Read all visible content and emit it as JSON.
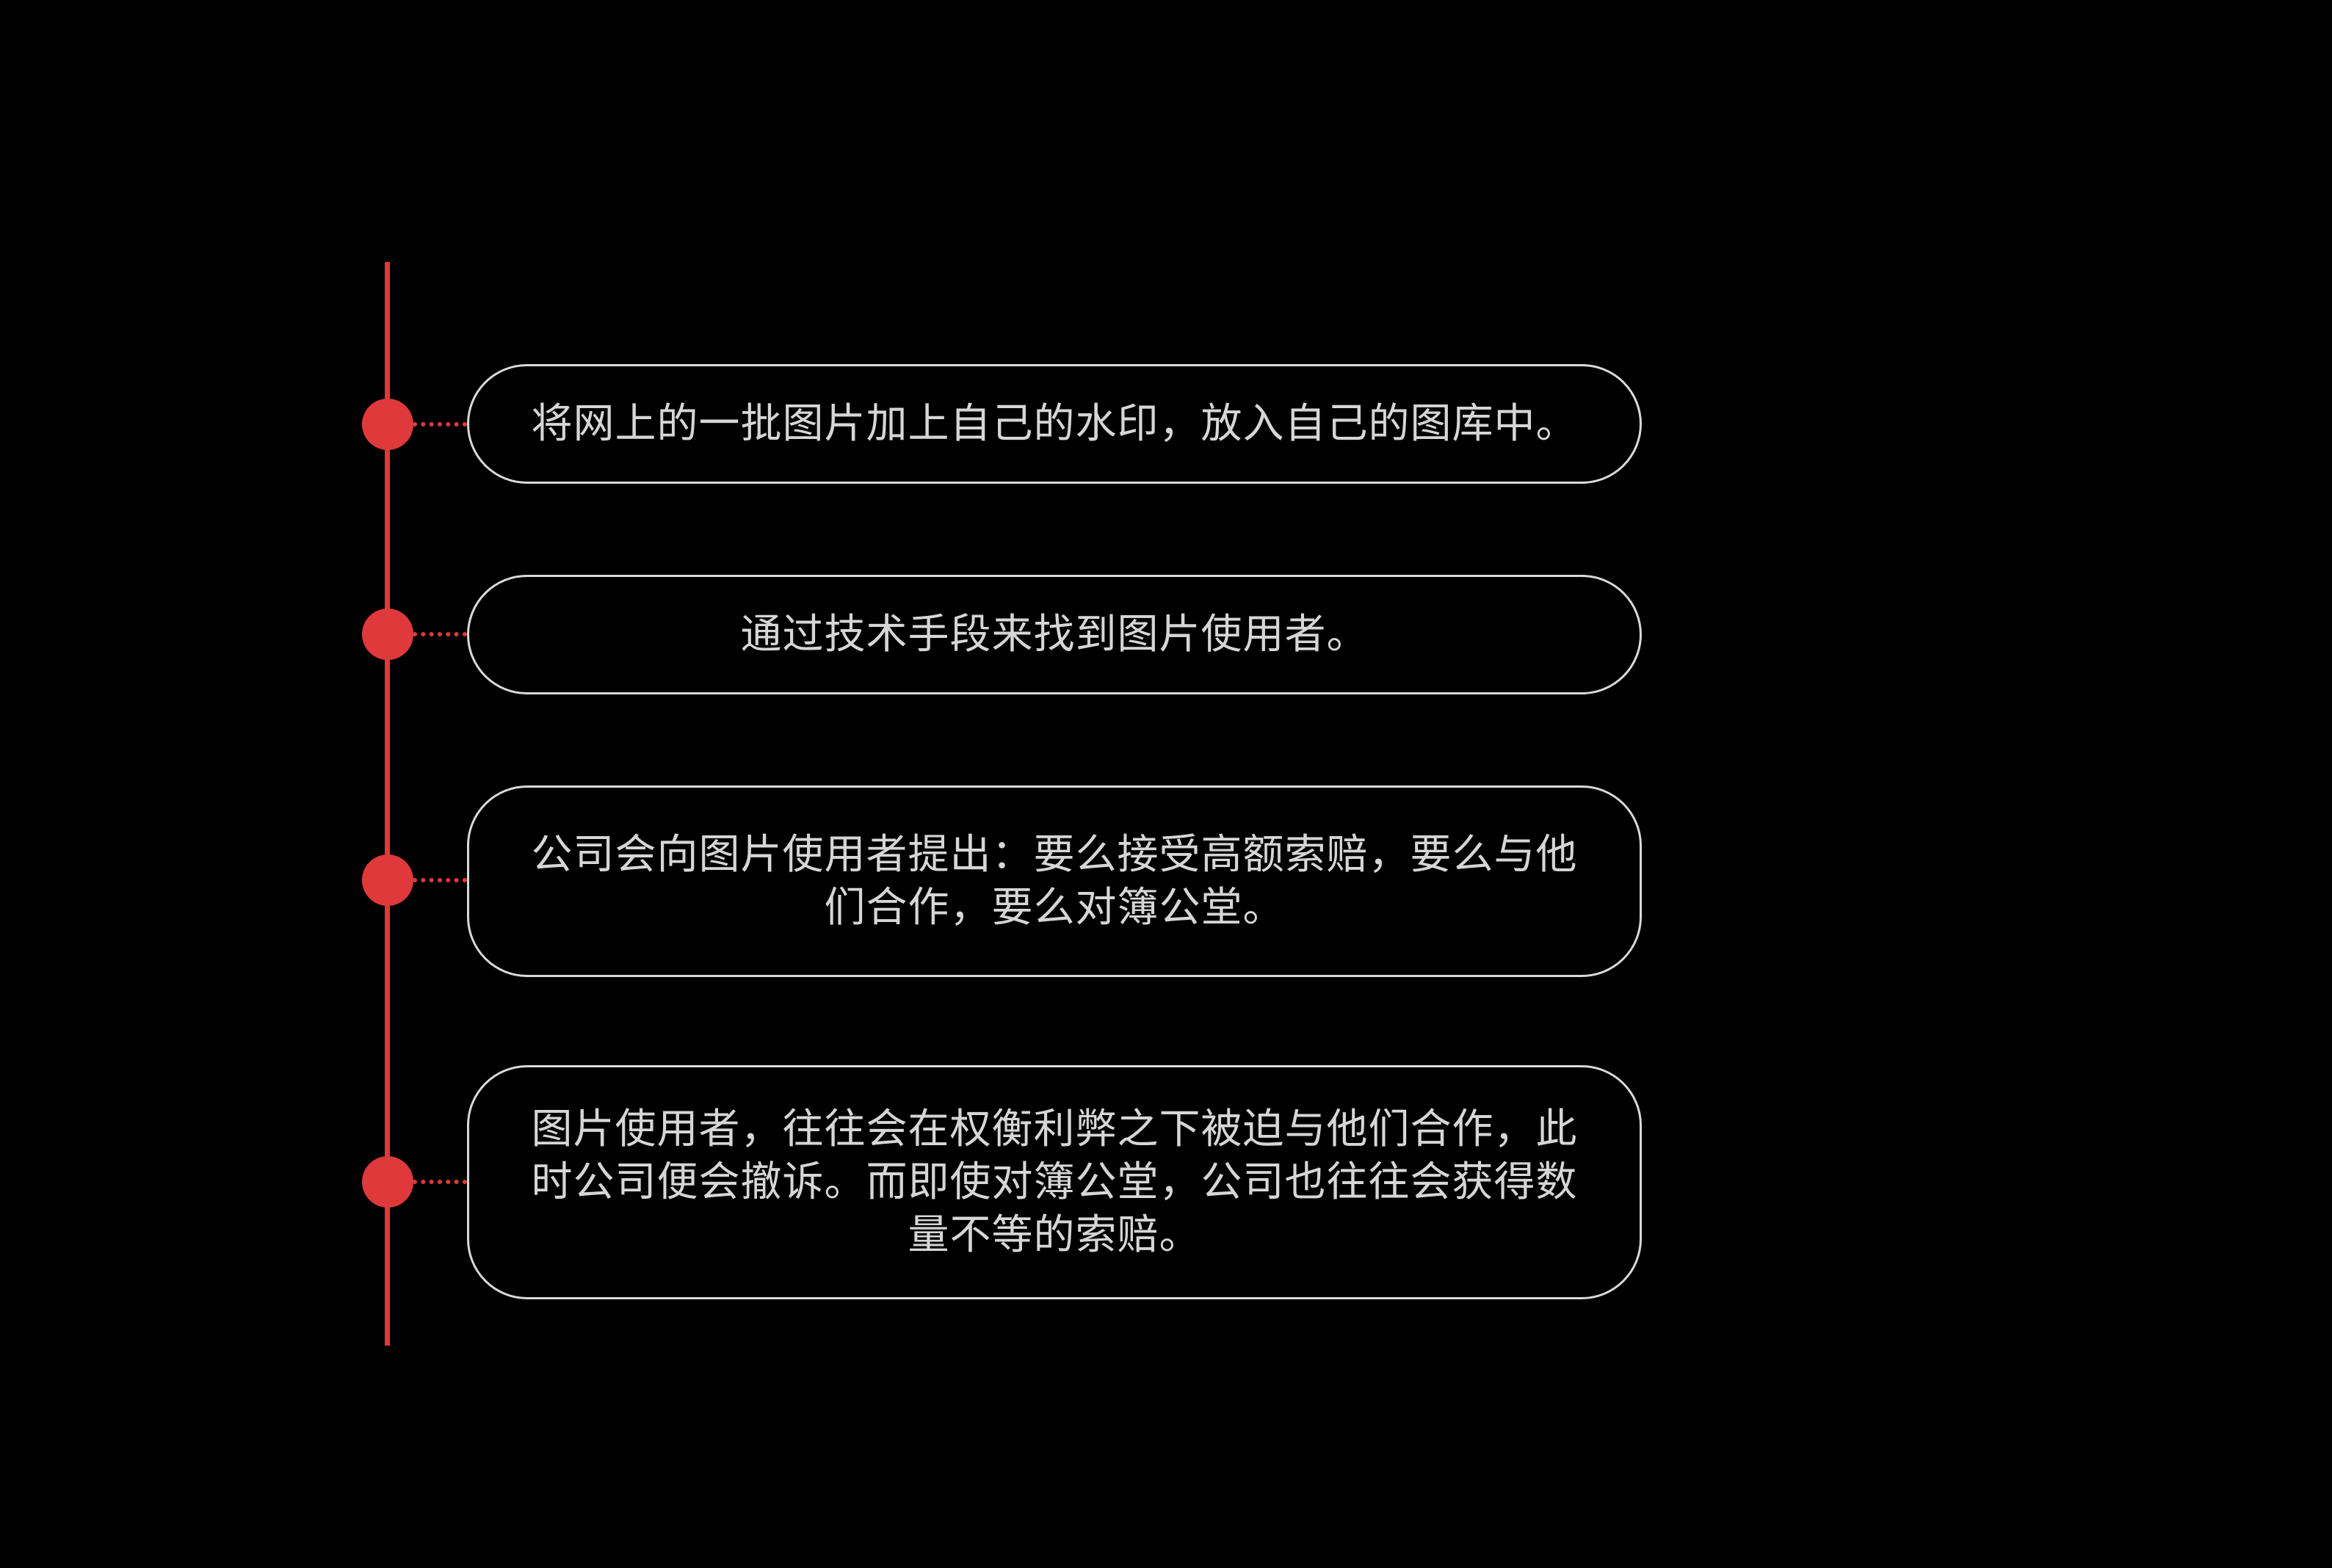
{
  "colors": {
    "background": "#000000",
    "accent": "#e0393b",
    "box_border": "#d9d9d9",
    "text": "#d6d6d6"
  },
  "steps": [
    {
      "text": "将网上的一批图片加上自己的水印，放入自己的图库中。"
    },
    {
      "text": "通过技术手段来找到图片使用者。"
    },
    {
      "text": "公司会向图片使用者提出：要么接受高额索赔，要么与他们合作，要么对簿公堂。"
    },
    {
      "text": "图片使用者，往往会在权衡利弊之下被迫与他们合作，此时公司便会撤诉。而即使对簿公堂，公司也往往会获得数量不等的索赔。"
    }
  ]
}
